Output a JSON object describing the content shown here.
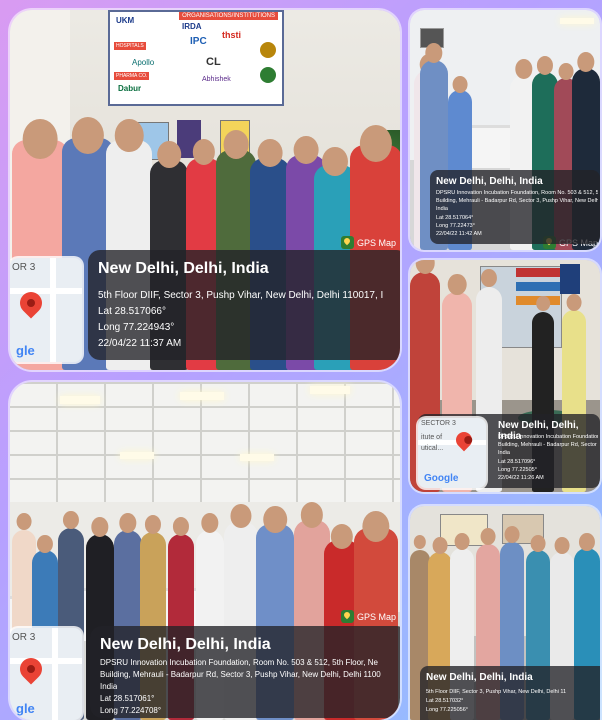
{
  "colors": {
    "map_pin": "#ea4335",
    "overlay_bg": "#232328",
    "gps_badge": "#2e7d32"
  },
  "cards": [
    {
      "id": "main",
      "city": "New Delhi, Delhi, India",
      "address": "5th Floor DIIF, Sector 3, Pushp Vihar, New Delhi, Delhi 110017, I",
      "lat": "Lat 28.517066°",
      "long": "Long 77.224943°",
      "datetime": "22/04/22 11:37 AM",
      "gps_label": "GPS Map",
      "map_sector": "OR 3",
      "google": "gle",
      "poster_header": "ORGANISATIONS/INSTITUTIONS",
      "poster_items": [
        "UKM",
        "IRDA",
        "thsti",
        "IPC",
        "CL",
        "Apollo",
        "Abhishek",
        "Dabur"
      ],
      "poster_sections": [
        "HOSPITALS",
        "PHARMA CO."
      ]
    },
    {
      "id": "top-right",
      "city": "New Delhi, Delhi, India",
      "address": "DPSRU Innovation Incubation Foundation, Room No. 503 & 512, 5th",
      "address2": "Building, Mehrauli - Badarpur Rd, Sector 3, Pushp Vihar, New Delhi",
      "address3": "India",
      "lat": "Lat 28.517064°",
      "long": "Long 77.22473°",
      "datetime": "22/04/22 11:42 AM",
      "gps_label": "GPS Map"
    },
    {
      "id": "mid-right",
      "city": "New Delhi, Delhi, India",
      "address": "DPSRU Innovation Incubation Foundation, Room",
      "address2": "Building, Mehrauli - Badarpur Rd, Sector 3",
      "address3": "India",
      "lat": "Lat 28.517096°",
      "long": "Long 77.22505°",
      "datetime": "22/04/22 11:26 AM",
      "map_sector": "SECTOR 3",
      "map_text": "itute of",
      "map_text2": "utical...",
      "google": "Google"
    },
    {
      "id": "bottom-left",
      "city": "New Delhi, Delhi, India",
      "address": "DPSRU Innovation Incubation Foundation, Room No. 503 & 512, 5th Floor, Ne",
      "address2": "Building, Mehrauli - Badarpur Rd, Sector 3, Pushp Vihar, New Delhi, Delhi 1100",
      "address3": "India",
      "lat": "Lat 28.517061°",
      "long": "Long 77.224708°",
      "gps_label": "GPS Map",
      "map_sector": "OR 3",
      "google": "gle"
    },
    {
      "id": "bottom-right",
      "city": "New Delhi, Delhi, India",
      "address": "5th Floor DIIF, Sector 3, Pushp Vihar, New Delhi, Delhi 11",
      "lat": "Lat 28.517032°",
      "long": "Long 77.225056°"
    }
  ]
}
